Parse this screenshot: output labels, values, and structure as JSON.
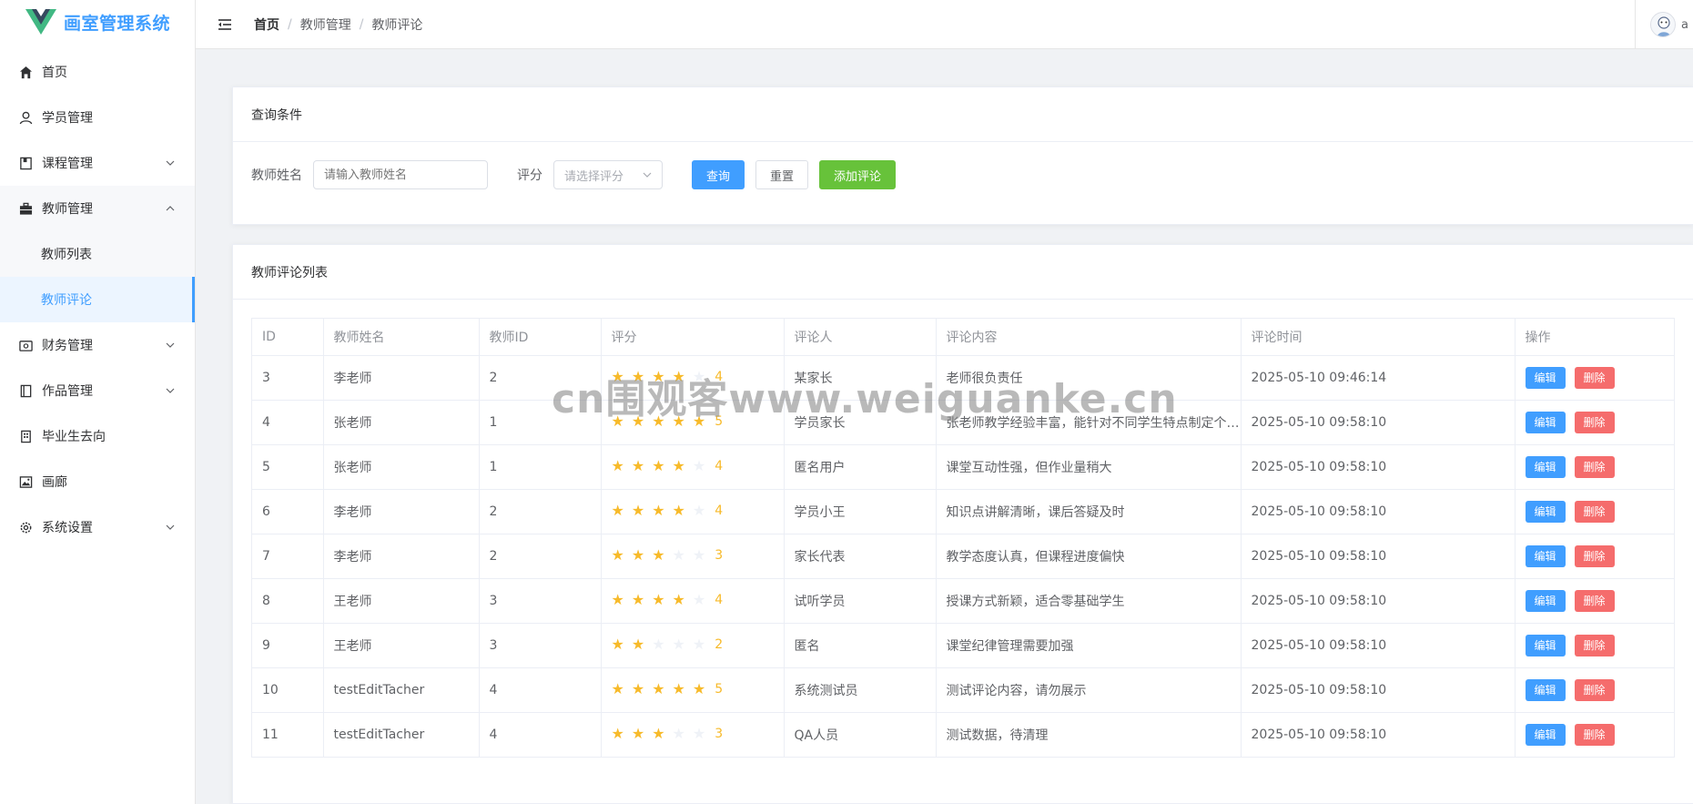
{
  "app": {
    "title": "画室管理系统"
  },
  "colors": {
    "primary": "#409eff",
    "success": "#67c23a",
    "danger": "#f56c6c",
    "star": "#f7ba2a"
  },
  "sidebar": {
    "items": [
      {
        "label": "首页",
        "icon": "home-icon"
      },
      {
        "label": "学员管理",
        "icon": "user-icon"
      },
      {
        "label": "课程管理",
        "icon": "book-icon"
      },
      {
        "label": "教师管理",
        "icon": "briefcase-icon"
      },
      {
        "label": "财务管理",
        "icon": "wallet-icon"
      },
      {
        "label": "作品管理",
        "icon": "notebook-icon"
      },
      {
        "label": "毕业生去向",
        "icon": "building-icon"
      },
      {
        "label": "画廊",
        "icon": "picture-icon"
      },
      {
        "label": "系统设置",
        "icon": "gear-icon"
      }
    ],
    "teacher_sub": [
      {
        "label": "教师列表"
      },
      {
        "label": "教师评论"
      }
    ]
  },
  "header": {
    "breadcrumb": [
      "首页",
      "教师管理",
      "教师评论"
    ],
    "separator": "/",
    "user_text": "a"
  },
  "query": {
    "title": "查询条件",
    "teacher_label": "教师姓名",
    "teacher_placeholder": "请输入教师姓名",
    "rating_label": "评分",
    "rating_placeholder": "请选择评分",
    "search_btn": "查询",
    "reset_btn": "重置",
    "add_btn": "添加评论"
  },
  "list": {
    "title": "教师评论列表",
    "columns": [
      "ID",
      "教师姓名",
      "教师ID",
      "评分",
      "评论人",
      "评论内容",
      "评论时间",
      "操作"
    ],
    "edit_label": "编辑",
    "delete_label": "删除",
    "rows": [
      {
        "id": "3",
        "teacher": "李老师",
        "tid": "2",
        "rating": 4,
        "rating_text": "4",
        "reviewer": "某家长",
        "content": "老师很负责任",
        "time": "2025-05-10 09:46:14"
      },
      {
        "id": "4",
        "teacher": "张老师",
        "tid": "1",
        "rating": 5,
        "rating_text": "5",
        "reviewer": "学员家长",
        "content": "张老师教学经验丰富，能针对不同学生特点制定个性化教学方案",
        "time": "2025-05-10 09:58:10"
      },
      {
        "id": "5",
        "teacher": "张老师",
        "tid": "1",
        "rating": 4,
        "rating_text": "4",
        "reviewer": "匿名用户",
        "content": "课堂互动性强，但作业量稍大",
        "time": "2025-05-10 09:58:10"
      },
      {
        "id": "6",
        "teacher": "李老师",
        "tid": "2",
        "rating": 4,
        "rating_text": "4",
        "reviewer": "学员小王",
        "content": "知识点讲解清晰，课后答疑及时",
        "time": "2025-05-10 09:58:10"
      },
      {
        "id": "7",
        "teacher": "李老师",
        "tid": "2",
        "rating": 3,
        "rating_text": "3",
        "reviewer": "家长代表",
        "content": "教学态度认真，但课程进度偏快",
        "time": "2025-05-10 09:58:10"
      },
      {
        "id": "8",
        "teacher": "王老师",
        "tid": "3",
        "rating": 4,
        "rating_text": "4",
        "reviewer": "试听学员",
        "content": "授课方式新颖，适合零基础学生",
        "time": "2025-05-10 09:58:10"
      },
      {
        "id": "9",
        "teacher": "王老师",
        "tid": "3",
        "rating": 2,
        "rating_text": "2",
        "reviewer": "匿名",
        "content": "课堂纪律管理需要加强",
        "time": "2025-05-10 09:58:10"
      },
      {
        "id": "10",
        "teacher": "testEditTacher",
        "tid": "4",
        "rating": 5,
        "rating_text": "5",
        "reviewer": "系统测试员",
        "content": "测试评论内容，请勿展示",
        "time": "2025-05-10 09:58:10"
      },
      {
        "id": "11",
        "teacher": "testEditTacher",
        "tid": "4",
        "rating": 3,
        "rating_text": "3",
        "reviewer": "QA人员",
        "content": "测试数据，待清理",
        "time": "2025-05-10 09:58:10"
      }
    ]
  },
  "watermark": "cn围观客www.weiguanke.cn"
}
